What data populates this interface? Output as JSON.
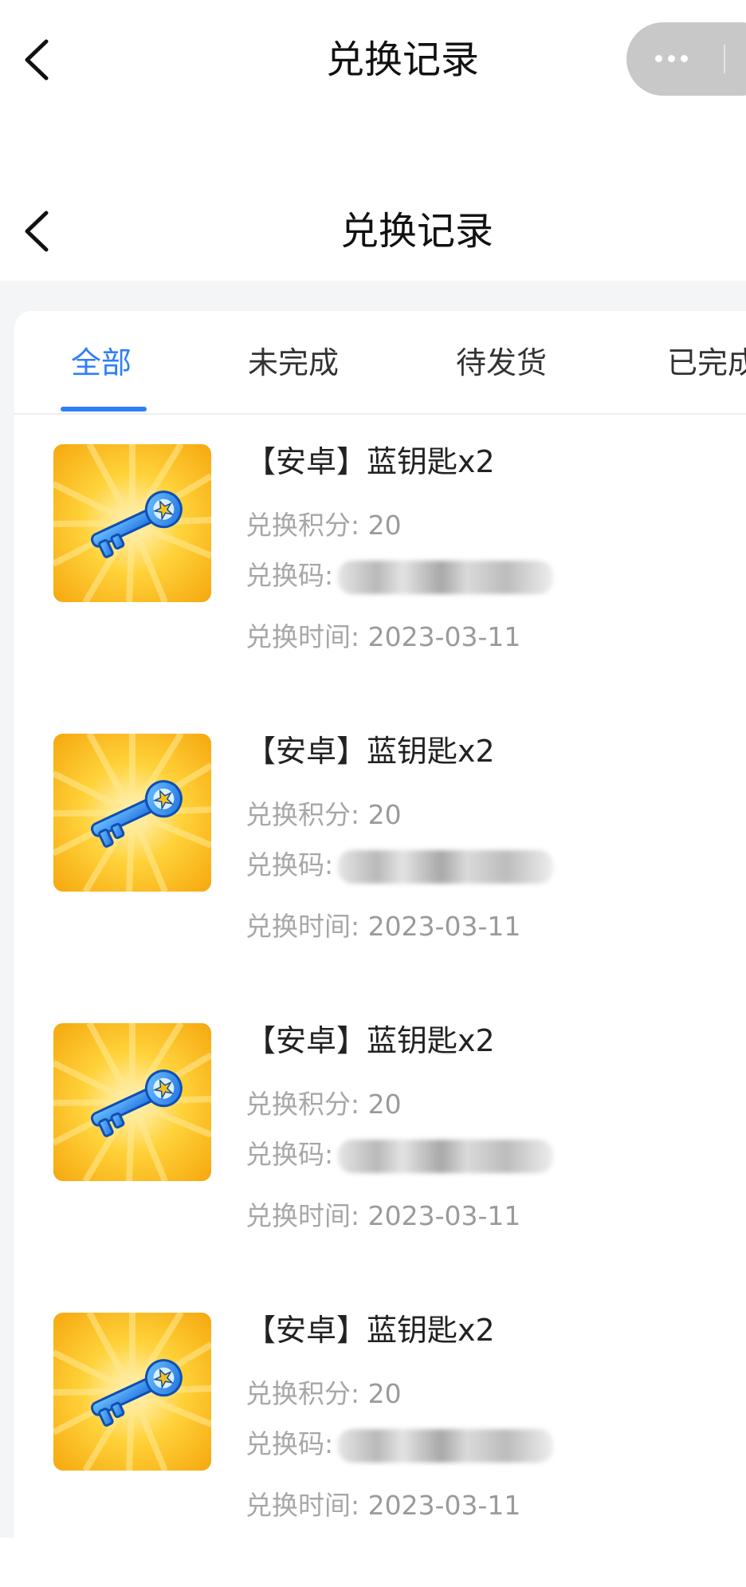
{
  "outer_nav": {
    "title": "兑换记录",
    "back_icon": "chevron-left-icon",
    "menu_icon": "more-dots-icon"
  },
  "inner_nav": {
    "title": "兑换记录",
    "back_icon": "chevron-left-icon"
  },
  "tabs": [
    {
      "label": "全部",
      "active": true
    },
    {
      "label": "未完成",
      "active": false
    },
    {
      "label": "待发货",
      "active": false
    },
    {
      "label": "已完成",
      "active": false
    }
  ],
  "colors": {
    "accent": "#2f7ef7",
    "page_bg": "#f4f5f7",
    "meta_text": "#9a9a9a"
  },
  "records": [
    {
      "title": "【安卓】蓝钥匙x2",
      "points_label": "兑换积分:",
      "points": "20",
      "code_label": "兑换码:",
      "time_label": "兑换时间:",
      "time": "2023-03-11",
      "icon": "blue-key-icon"
    },
    {
      "title": "【安卓】蓝钥匙x2",
      "points_label": "兑换积分:",
      "points": "20",
      "code_label": "兑换码:",
      "time_label": "兑换时间:",
      "time": "2023-03-11",
      "icon": "blue-key-icon"
    },
    {
      "title": "【安卓】蓝钥匙x2",
      "points_label": "兑换积分:",
      "points": "20",
      "code_label": "兑换码:",
      "time_label": "兑换时间:",
      "time": "2023-03-11",
      "icon": "blue-key-icon"
    },
    {
      "title": "【安卓】蓝钥匙x2",
      "points_label": "兑换积分:",
      "points": "20",
      "code_label": "兑换码:",
      "time_label": "兑换时间:",
      "time": "2023-03-11",
      "icon": "blue-key-icon"
    }
  ]
}
